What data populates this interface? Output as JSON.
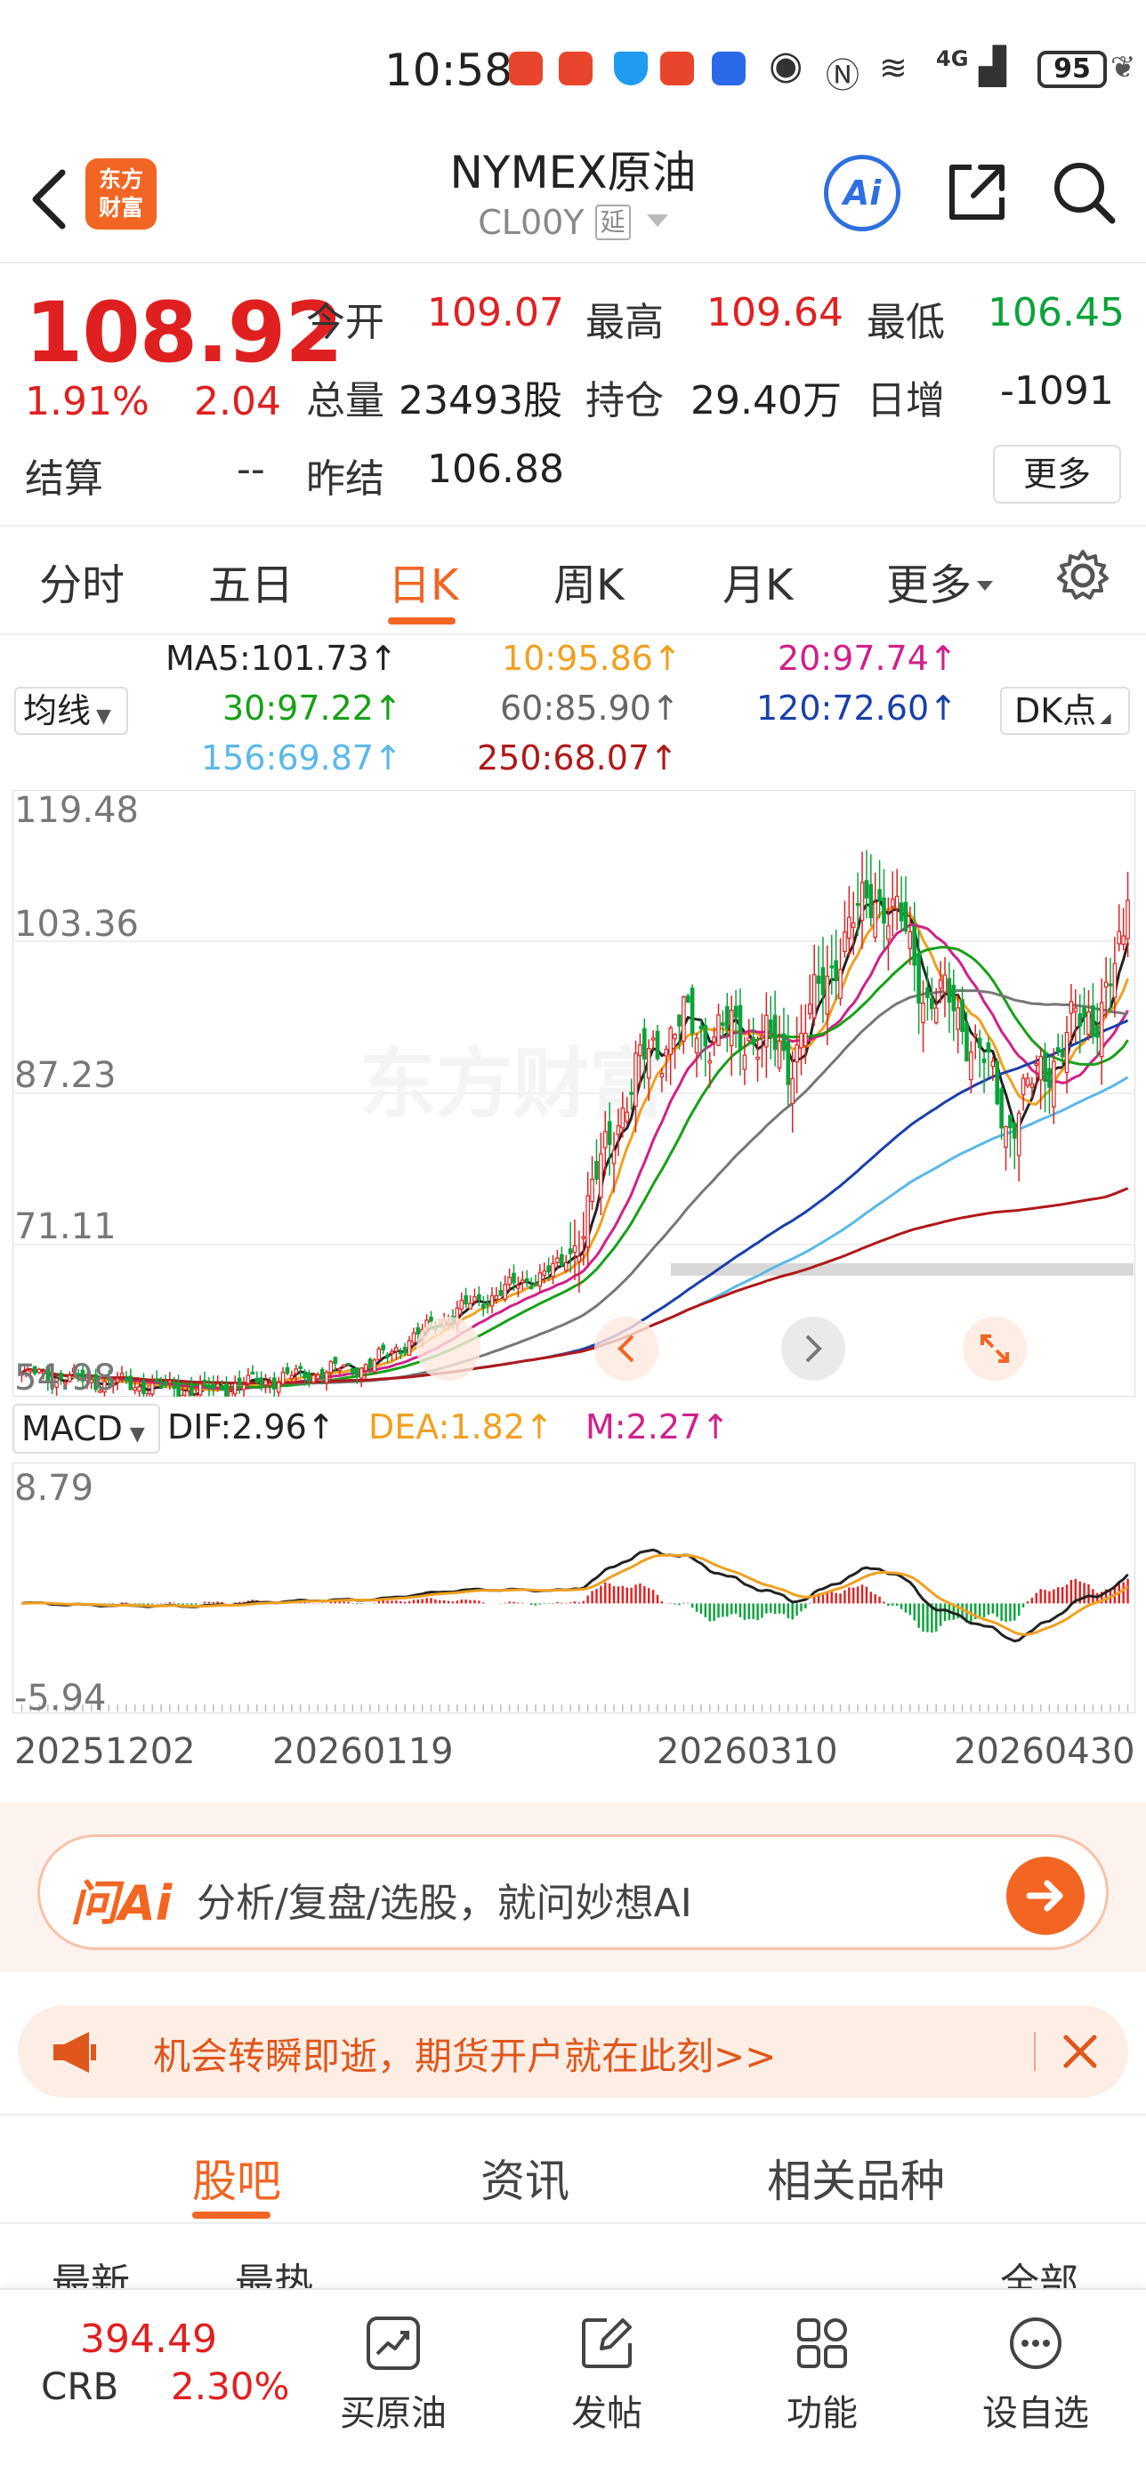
{
  "status_bar": {
    "time": "10:58",
    "battery": "95",
    "network": "4G"
  },
  "header": {
    "back_icon": "chevron-left-icon",
    "logo_line1": "东方",
    "logo_line2": "财富",
    "title": "NYMEX原油",
    "subtitle": "CL00Y",
    "delay_badge": "延",
    "ai_label": "Ai",
    "share_icon": "share-icon",
    "search_icon": "search-icon"
  },
  "quote": {
    "price": "108.92",
    "change_pct": "1.91%",
    "change": "2.04",
    "settle_label": "结算",
    "settle_value": "--",
    "open_label": "今开",
    "open_value": "109.07",
    "high_label": "最高",
    "high_value": "109.64",
    "low_label": "最低",
    "low_value": "106.45",
    "volume_label": "总量",
    "volume_value": "23493股",
    "oi_label": "持仓",
    "oi_value": "29.40万",
    "daily_inc_label": "日增",
    "daily_inc_value": "-1091",
    "prev_settle_label": "昨结",
    "prev_settle_value": "106.88",
    "more_label": "更多"
  },
  "tabs": [
    "分时",
    "五日",
    "日K",
    "周K",
    "月K",
    "更多"
  ],
  "active_tab": "日K",
  "ma_legend": {
    "selector": "均线",
    "ma5": "MA5:101.73↑",
    "ma10": "10:95.86↑",
    "ma20": "20:97.74↑",
    "ma30": "30:97.22↑",
    "ma60": "60:85.90↑",
    "ma120": "120:72.60↑",
    "ma156": "156:69.87↑",
    "ma250": "250:68.07↑",
    "dk_label": "DK点"
  },
  "colors": {
    "up": "#e02020",
    "down": "#0aa33a",
    "accent": "#f26522",
    "ma5": "#222222",
    "ma10": "#f0a020",
    "ma20": "#d0208a",
    "ma30": "#18a018",
    "ma60": "#777777",
    "ma120": "#1a3fa8",
    "ma156": "#5bb8e8",
    "ma250": "#b01818"
  },
  "macd_legend": {
    "selector": "MACD",
    "dif": "DIF:2.96↑",
    "dea": "DEA:1.82↑",
    "m": "M:2.27↑"
  },
  "chart_data": [
    {
      "type": "candlestick",
      "y_ticks": [
        "119.48",
        "103.36",
        "87.23",
        "71.11",
        "54.98"
      ],
      "ylim": [
        54.98,
        119.48
      ],
      "last_close": 108.92
    },
    {
      "type": "macd",
      "y_ticks": [
        "8.79",
        "-5.94"
      ],
      "ylim": [
        -5.94,
        8.79
      ],
      "x_ticks": [
        "20251202",
        "20260119",
        "20260310",
        "20260430"
      ]
    }
  ],
  "ask_ai": {
    "logo": "问Ai",
    "placeholder": "分析/复盘/选股，就问妙想AI"
  },
  "banner": {
    "text": "机会转瞬即逝，期货开户就在此刻>>"
  },
  "sub_tabs": [
    "股吧",
    "资讯",
    "相关品种"
  ],
  "active_sub_tab": "股吧",
  "peek_items": [
    "最新",
    "最热",
    "全部"
  ],
  "bottom_bar": {
    "crb_value": "394.49",
    "crb_name": "CRB",
    "crb_pct": "2.30%",
    "nav": [
      "买原油",
      "发帖",
      "功能",
      "设自选"
    ]
  }
}
